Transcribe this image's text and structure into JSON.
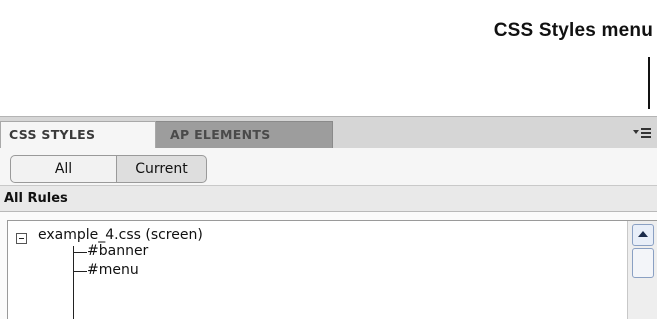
{
  "callout": {
    "label": "CSS Styles menu"
  },
  "panel": {
    "tabs": [
      {
        "label": "CSS STYLES",
        "active": true
      },
      {
        "label": "AP ELEMENTS",
        "active": false
      }
    ],
    "menu_icon": "panel-options-menu-icon",
    "toolbar": {
      "all_label": "All",
      "current_label": "Current",
      "selected": "All"
    },
    "section_title": "All Rules",
    "tree": {
      "root": {
        "label": "example_4.css (screen)",
        "expanded": true
      },
      "children": [
        "#banner",
        "#menu"
      ]
    }
  },
  "colors": {
    "tabbar_bg": "#d6d6d6",
    "inactive_tab_bg": "#9d9d9d",
    "panel_bg": "#f6f6f6"
  }
}
